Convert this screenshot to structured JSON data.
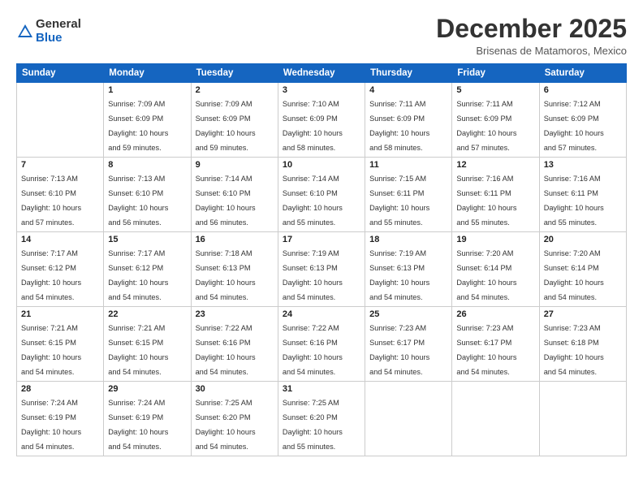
{
  "logo": {
    "general": "General",
    "blue": "Blue"
  },
  "title": "December 2025",
  "subtitle": "Brisenas de Matamoros, Mexico",
  "days_of_week": [
    "Sunday",
    "Monday",
    "Tuesday",
    "Wednesday",
    "Thursday",
    "Friday",
    "Saturday"
  ],
  "weeks": [
    [
      {
        "day": "",
        "sunrise": "",
        "sunset": "",
        "daylight": ""
      },
      {
        "day": "1",
        "sunrise": "Sunrise: 7:09 AM",
        "sunset": "Sunset: 6:09 PM",
        "daylight": "Daylight: 10 hours and 59 minutes."
      },
      {
        "day": "2",
        "sunrise": "Sunrise: 7:09 AM",
        "sunset": "Sunset: 6:09 PM",
        "daylight": "Daylight: 10 hours and 59 minutes."
      },
      {
        "day": "3",
        "sunrise": "Sunrise: 7:10 AM",
        "sunset": "Sunset: 6:09 PM",
        "daylight": "Daylight: 10 hours and 58 minutes."
      },
      {
        "day": "4",
        "sunrise": "Sunrise: 7:11 AM",
        "sunset": "Sunset: 6:09 PM",
        "daylight": "Daylight: 10 hours and 58 minutes."
      },
      {
        "day": "5",
        "sunrise": "Sunrise: 7:11 AM",
        "sunset": "Sunset: 6:09 PM",
        "daylight": "Daylight: 10 hours and 57 minutes."
      },
      {
        "day": "6",
        "sunrise": "Sunrise: 7:12 AM",
        "sunset": "Sunset: 6:09 PM",
        "daylight": "Daylight: 10 hours and 57 minutes."
      }
    ],
    [
      {
        "day": "7",
        "sunrise": "Sunrise: 7:13 AM",
        "sunset": "Sunset: 6:10 PM",
        "daylight": "Daylight: 10 hours and 57 minutes."
      },
      {
        "day": "8",
        "sunrise": "Sunrise: 7:13 AM",
        "sunset": "Sunset: 6:10 PM",
        "daylight": "Daylight: 10 hours and 56 minutes."
      },
      {
        "day": "9",
        "sunrise": "Sunrise: 7:14 AM",
        "sunset": "Sunset: 6:10 PM",
        "daylight": "Daylight: 10 hours and 56 minutes."
      },
      {
        "day": "10",
        "sunrise": "Sunrise: 7:14 AM",
        "sunset": "Sunset: 6:10 PM",
        "daylight": "Daylight: 10 hours and 55 minutes."
      },
      {
        "day": "11",
        "sunrise": "Sunrise: 7:15 AM",
        "sunset": "Sunset: 6:11 PM",
        "daylight": "Daylight: 10 hours and 55 minutes."
      },
      {
        "day": "12",
        "sunrise": "Sunrise: 7:16 AM",
        "sunset": "Sunset: 6:11 PM",
        "daylight": "Daylight: 10 hours and 55 minutes."
      },
      {
        "day": "13",
        "sunrise": "Sunrise: 7:16 AM",
        "sunset": "Sunset: 6:11 PM",
        "daylight": "Daylight: 10 hours and 55 minutes."
      }
    ],
    [
      {
        "day": "14",
        "sunrise": "Sunrise: 7:17 AM",
        "sunset": "Sunset: 6:12 PM",
        "daylight": "Daylight: 10 hours and 54 minutes."
      },
      {
        "day": "15",
        "sunrise": "Sunrise: 7:17 AM",
        "sunset": "Sunset: 6:12 PM",
        "daylight": "Daylight: 10 hours and 54 minutes."
      },
      {
        "day": "16",
        "sunrise": "Sunrise: 7:18 AM",
        "sunset": "Sunset: 6:13 PM",
        "daylight": "Daylight: 10 hours and 54 minutes."
      },
      {
        "day": "17",
        "sunrise": "Sunrise: 7:19 AM",
        "sunset": "Sunset: 6:13 PM",
        "daylight": "Daylight: 10 hours and 54 minutes."
      },
      {
        "day": "18",
        "sunrise": "Sunrise: 7:19 AM",
        "sunset": "Sunset: 6:13 PM",
        "daylight": "Daylight: 10 hours and 54 minutes."
      },
      {
        "day": "19",
        "sunrise": "Sunrise: 7:20 AM",
        "sunset": "Sunset: 6:14 PM",
        "daylight": "Daylight: 10 hours and 54 minutes."
      },
      {
        "day": "20",
        "sunrise": "Sunrise: 7:20 AM",
        "sunset": "Sunset: 6:14 PM",
        "daylight": "Daylight: 10 hours and 54 minutes."
      }
    ],
    [
      {
        "day": "21",
        "sunrise": "Sunrise: 7:21 AM",
        "sunset": "Sunset: 6:15 PM",
        "daylight": "Daylight: 10 hours and 54 minutes."
      },
      {
        "day": "22",
        "sunrise": "Sunrise: 7:21 AM",
        "sunset": "Sunset: 6:15 PM",
        "daylight": "Daylight: 10 hours and 54 minutes."
      },
      {
        "day": "23",
        "sunrise": "Sunrise: 7:22 AM",
        "sunset": "Sunset: 6:16 PM",
        "daylight": "Daylight: 10 hours and 54 minutes."
      },
      {
        "day": "24",
        "sunrise": "Sunrise: 7:22 AM",
        "sunset": "Sunset: 6:16 PM",
        "daylight": "Daylight: 10 hours and 54 minutes."
      },
      {
        "day": "25",
        "sunrise": "Sunrise: 7:23 AM",
        "sunset": "Sunset: 6:17 PM",
        "daylight": "Daylight: 10 hours and 54 minutes."
      },
      {
        "day": "26",
        "sunrise": "Sunrise: 7:23 AM",
        "sunset": "Sunset: 6:17 PM",
        "daylight": "Daylight: 10 hours and 54 minutes."
      },
      {
        "day": "27",
        "sunrise": "Sunrise: 7:23 AM",
        "sunset": "Sunset: 6:18 PM",
        "daylight": "Daylight: 10 hours and 54 minutes."
      }
    ],
    [
      {
        "day": "28",
        "sunrise": "Sunrise: 7:24 AM",
        "sunset": "Sunset: 6:19 PM",
        "daylight": "Daylight: 10 hours and 54 minutes."
      },
      {
        "day": "29",
        "sunrise": "Sunrise: 7:24 AM",
        "sunset": "Sunset: 6:19 PM",
        "daylight": "Daylight: 10 hours and 54 minutes."
      },
      {
        "day": "30",
        "sunrise": "Sunrise: 7:25 AM",
        "sunset": "Sunset: 6:20 PM",
        "daylight": "Daylight: 10 hours and 54 minutes."
      },
      {
        "day": "31",
        "sunrise": "Sunrise: 7:25 AM",
        "sunset": "Sunset: 6:20 PM",
        "daylight": "Daylight: 10 hours and 55 minutes."
      },
      {
        "day": "",
        "sunrise": "",
        "sunset": "",
        "daylight": ""
      },
      {
        "day": "",
        "sunrise": "",
        "sunset": "",
        "daylight": ""
      },
      {
        "day": "",
        "sunrise": "",
        "sunset": "",
        "daylight": ""
      }
    ]
  ]
}
